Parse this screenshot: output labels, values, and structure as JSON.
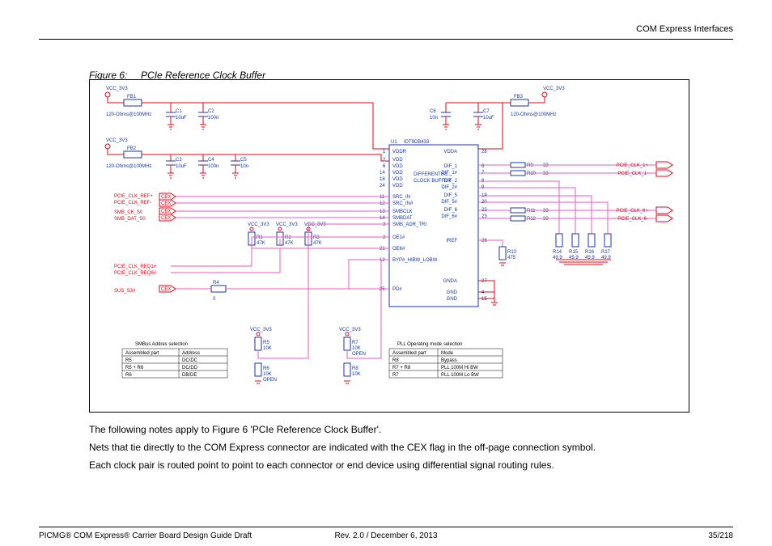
{
  "header": {
    "section": "COM Express Interfaces"
  },
  "figure": {
    "label": "Figure 6:",
    "title": "PCIe Reference Clock Buffer"
  },
  "rails": {
    "vcc": "VCC_3V3"
  },
  "ferrites": {
    "fb1": {
      "ref": "FB1",
      "spec": "120-Ohms@100MHz"
    },
    "fb2": {
      "ref": "FB2",
      "spec": "120-Ohms@100MHz"
    },
    "fb3": {
      "ref": "FB3",
      "spec": "120-Ohms@100MHz"
    }
  },
  "caps": {
    "c1": {
      "ref": "C1",
      "val": "10uF"
    },
    "c2": {
      "ref": "C2",
      "val": "100n"
    },
    "c3": {
      "ref": "C3",
      "val": "10uF"
    },
    "c4": {
      "ref": "C4",
      "val": "100n"
    },
    "c5": {
      "ref": "C5",
      "val": "10n"
    },
    "c6": {
      "ref": "C6",
      "val": "10n"
    },
    "c7": {
      "ref": "C7",
      "val": "10uF"
    }
  },
  "resistors": {
    "r1": {
      "ref": "R1",
      "val": "47K"
    },
    "r2": {
      "ref": "R2",
      "val": "47K"
    },
    "r3": {
      "ref": "R3",
      "val": "47K"
    },
    "r4": {
      "ref": "R4",
      "val": "0"
    },
    "r5": {
      "ref": "R5",
      "val": "10K"
    },
    "r6": {
      "ref": "R6",
      "val": "10K",
      "note": "OPEN"
    },
    "r7": {
      "ref": "R7",
      "val": "10K",
      "note": "OPEN"
    },
    "r8": {
      "ref": "R8",
      "val": "10K"
    },
    "r9": {
      "ref": "R9",
      "val": "33"
    },
    "r10": {
      "ref": "R10",
      "val": "33"
    },
    "r11": {
      "ref": "R11",
      "val": "33"
    },
    "r12": {
      "ref": "R12",
      "val": "33"
    },
    "r13": {
      "ref": "R13",
      "val": "475"
    },
    "r14": {
      "ref": "R14",
      "val": "49.9"
    },
    "r15": {
      "ref": "R15",
      "val": "49.9"
    },
    "r16": {
      "ref": "R16",
      "val": "49.9"
    },
    "r17": {
      "ref": "R17",
      "val": "49.9"
    }
  },
  "ic": {
    "ref": "U1",
    "part": "IDT9DB433",
    "subtitle1": "DIFFERENTIAL",
    "subtitle2": "CLOCK BUFFER",
    "pins_left": [
      {
        "num": "1",
        "name": "VDDR"
      },
      {
        "num": "2",
        "name": "VDD"
      },
      {
        "num": "6",
        "name": "VDD"
      },
      {
        "num": "14",
        "name": "VDD"
      },
      {
        "num": "18",
        "name": "VDD"
      },
      {
        "num": "24",
        "name": "VDD"
      },
      {
        "num": "11",
        "name": "SRC_IN"
      },
      {
        "num": "12",
        "name": "SRC_IN#"
      },
      {
        "num": "13",
        "name": "SMBCLK"
      },
      {
        "num": "14",
        "name": "SMBDAT"
      },
      {
        "num": "3",
        "name": "SMB_ADR_TRI"
      },
      {
        "num": "2",
        "name": "OE1#"
      },
      {
        "num": "21",
        "name": "OE6#"
      },
      {
        "num": "12",
        "name": "BYP#_HIBW_LOBW"
      },
      {
        "num": "25",
        "name": "PD#"
      }
    ],
    "pins_right": [
      {
        "num": "28",
        "name": "VDDA"
      },
      {
        "num": "6",
        "name": "DIF_1"
      },
      {
        "num": "7",
        "name": "DIF_1#"
      },
      {
        "num": "8",
        "name": "DIF_2"
      },
      {
        "num": "9",
        "name": "DIF_2#"
      },
      {
        "num": "19",
        "name": "DIF_5"
      },
      {
        "num": "20",
        "name": "DIF_5#"
      },
      {
        "num": "22",
        "name": "DIF_6"
      },
      {
        "num": "23",
        "name": "DIF_6#"
      },
      {
        "num": "26",
        "name": "IREF"
      },
      {
        "num": "27",
        "name": "GNDA"
      },
      {
        "num": "4",
        "name": "GND"
      },
      {
        "num": "15",
        "name": "GND"
      }
    ]
  },
  "nets": {
    "pcie_clk_ref_p": "PCIE_CLK_REF+",
    "pcie_clk_ref_n": "PCIE_CLK_REF-",
    "smb_ck": "SMB_CK_S0",
    "smb_dat": "SMB_DAT_S0",
    "pcie_clk_req1": "PCIE_CLK_REQ1#",
    "pcie_clk_req6": "PCIE_CLK_REQ6#",
    "sus_s3": "SUS_S3#",
    "pcie_clk_1p": "PCIE_CLK_1+",
    "pcie_clk_1n": "PCIE_CLK_1-",
    "pcie_clk_6p": "PCIE_CLK_6+",
    "pcie_clk_6n": "PCIE_CLK_6-",
    "cex": "CEX"
  },
  "tables": {
    "smbus": {
      "title": "SMBus Addres selection",
      "headers": [
        "Assembled part",
        "Address"
      ],
      "rows": [
        [
          "R5",
          "DC/DC"
        ],
        [
          "R5 + R6",
          "DC/DD"
        ],
        [
          "R6",
          "DB/DE"
        ]
      ]
    },
    "pll": {
      "title": "PLL Operating mode selection",
      "headers": [
        "Assembled part",
        "Mode"
      ],
      "rows": [
        [
          "R8",
          "Bypass"
        ],
        [
          "R7 + R8",
          "PLL 100M Hi BW"
        ],
        [
          "R7",
          "PLL 100M Lo BW"
        ]
      ]
    }
  },
  "notes": {
    "n1": "The following notes apply to Figure 6 'PCIe Reference Clock Buffer'.",
    "n2": "Nets that tie directly to the COM Express connector are indicated with the CEX flag in the off-page connection symbol.",
    "n3": "Each clock pair is routed point to point to each connector or end device using differential signal routing rules."
  },
  "footer": {
    "left": "PICMG® COM Express® Carrier Board Design Guide Draft",
    "mid": "Rev. 2.0 / December 6, 2013",
    "right": "35/218"
  }
}
